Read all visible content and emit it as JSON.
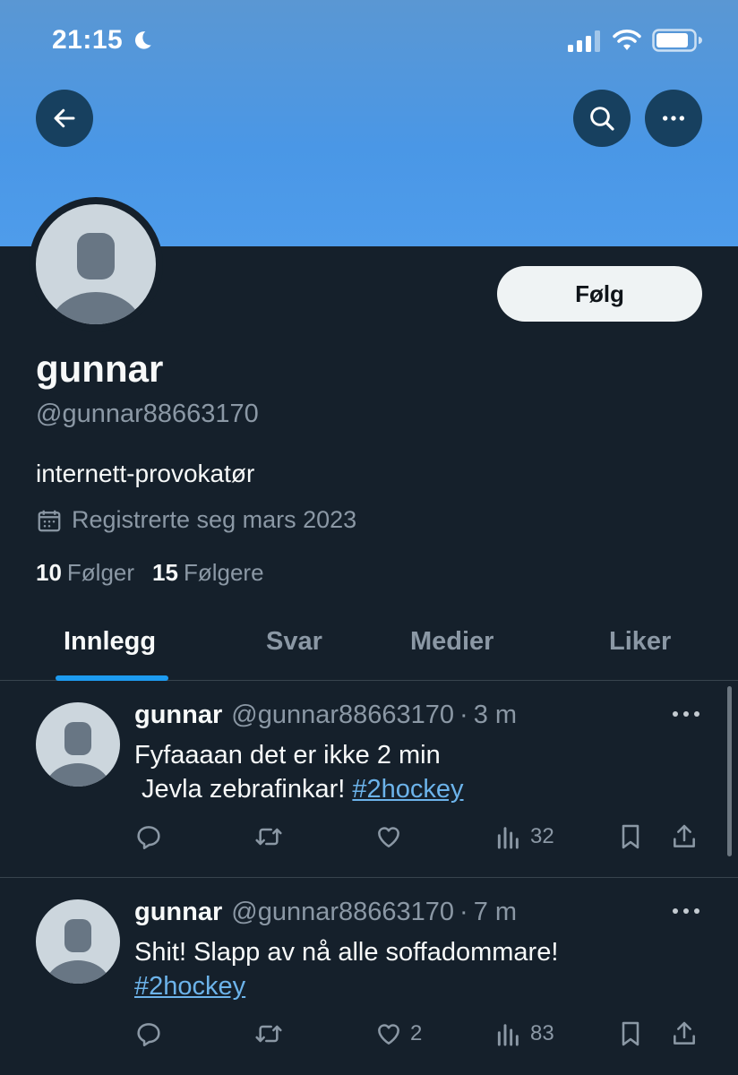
{
  "status_bar": {
    "time": "21:15"
  },
  "profile": {
    "display_name": "gunnar",
    "handle": "@gunnar88663170",
    "bio": "internett-provokatør",
    "joined": "Registrerte seg mars 2023",
    "following_count": "10",
    "following_label": "Følger",
    "followers_count": "15",
    "followers_label": "Følgere",
    "follow_button": "Følg"
  },
  "tabs": [
    {
      "label": "Innlegg",
      "active": true
    },
    {
      "label": "Svar",
      "active": false
    },
    {
      "label": "Medier",
      "active": false
    },
    {
      "label": "Liker",
      "active": false
    }
  ],
  "tweets": [
    {
      "name": "gunnar",
      "handle": "@gunnar88663170",
      "time": "3 m",
      "line1": "Fyfaaaan det er ikke 2 min",
      "line2_text": " Jevla zebrafinkar! ",
      "hashtag": "#2hockey",
      "likes": "",
      "views": "32"
    },
    {
      "name": "gunnar",
      "handle": "@gunnar88663170",
      "time": "7 m",
      "line1": "Shit! Slapp av nå alle soffadommare!",
      "hashtag": "#2hockey",
      "likes": "2",
      "views": "83"
    }
  ],
  "icons": {
    "back": "arrow-left-icon",
    "search": "search-icon",
    "more": "more-horizontal-icon",
    "calendar": "calendar-icon",
    "reply": "reply-icon",
    "retweet": "retweet-icon",
    "like": "heart-icon",
    "views": "views-icon",
    "bookmark": "bookmark-icon",
    "share": "share-icon"
  },
  "colors": {
    "background": "#15202b",
    "accent": "#1d9bf0",
    "hashtag": "#6cb3ea",
    "muted": "#8b98a5"
  }
}
